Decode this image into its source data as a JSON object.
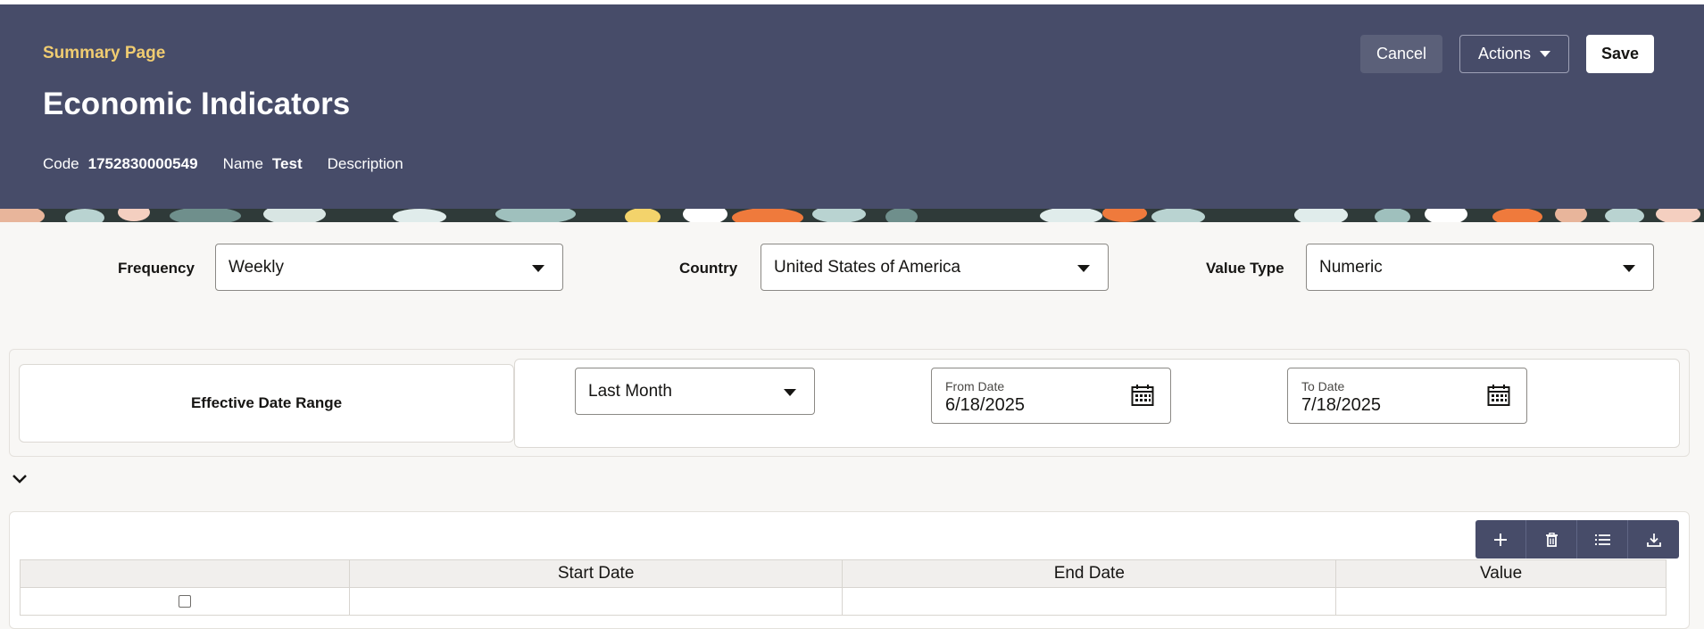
{
  "header": {
    "breadcrumb": "Summary Page",
    "title": "Economic Indicators",
    "code_label": "Code",
    "code_value": "1752830000549",
    "name_label": "Name",
    "name_value": "Test",
    "description_label": "Description",
    "cancel_label": "Cancel",
    "actions_label": "Actions",
    "save_label": "Save"
  },
  "filters": {
    "frequency_label": "Frequency",
    "frequency_value": "Weekly",
    "country_label": "Country",
    "country_value": "United States of America",
    "value_type_label": "Value Type",
    "value_type_value": "Numeric"
  },
  "date_range": {
    "label": "Effective Date Range",
    "preset_value": "Last Month",
    "from_label": "From Date",
    "from_value": "6/18/2025",
    "to_label": "To Date",
    "to_value": "7/18/2025"
  },
  "table": {
    "columns": [
      "",
      "Start Date",
      "End Date",
      "Value"
    ]
  },
  "icons": {
    "toolbar": [
      "plus-icon",
      "trash-icon",
      "list-icon",
      "download-icon"
    ],
    "date": "calendar-icon",
    "toggle": "chevron-down-icon"
  },
  "colors": {
    "header_bg": "#474c69",
    "breadcrumb": "#f0cc71",
    "toolbar_bg": "#474c69"
  }
}
